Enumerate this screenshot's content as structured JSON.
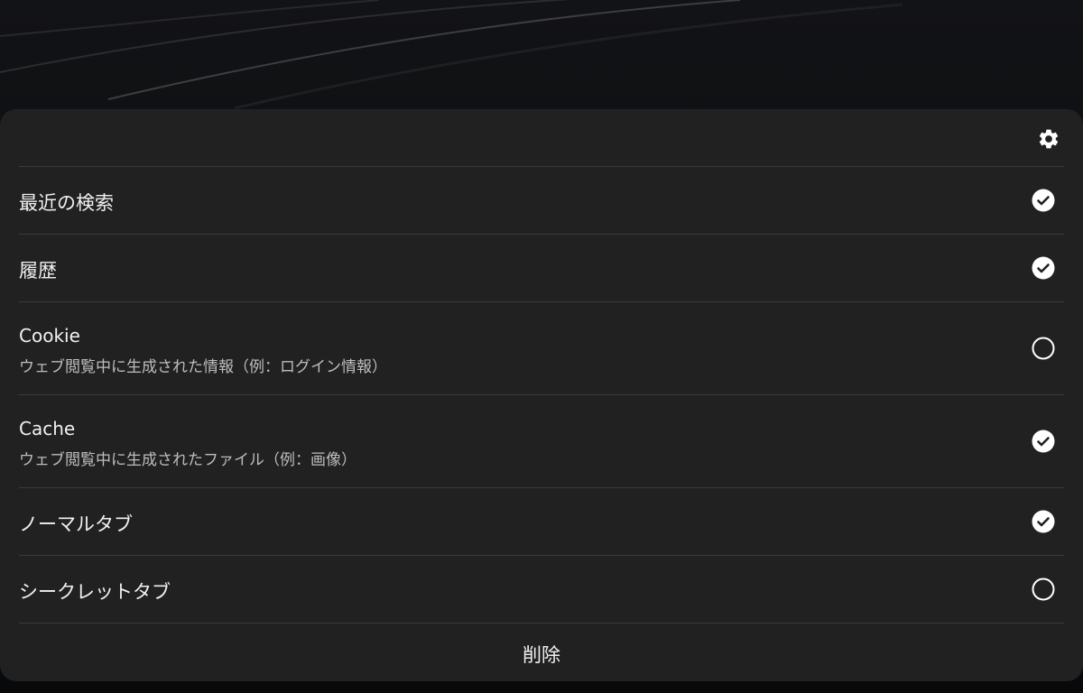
{
  "header": {
    "settings_icon": "gear-icon"
  },
  "options": [
    {
      "title": "最近の検索",
      "subtitle": "",
      "checked": true
    },
    {
      "title": "履歴",
      "subtitle": "",
      "checked": true
    },
    {
      "title": "Cookie",
      "subtitle": "ウェブ閲覧中に生成された情報（例：ログイン情報）",
      "checked": false
    },
    {
      "title": "Cache",
      "subtitle": "ウェブ閲覧中に生成されたファイル（例：画像）",
      "checked": true
    },
    {
      "title": "ノーマルタブ",
      "subtitle": "",
      "checked": true
    },
    {
      "title": "シークレットタブ",
      "subtitle": "",
      "checked": false
    }
  ],
  "footer": {
    "delete_label": "削除"
  },
  "colors": {
    "sheet_bg": "#212121",
    "divider": "#3a3a3a",
    "text_primary": "#f1f1f1",
    "text_secondary": "#bdbdbd",
    "check_fill": "#ffffff"
  }
}
